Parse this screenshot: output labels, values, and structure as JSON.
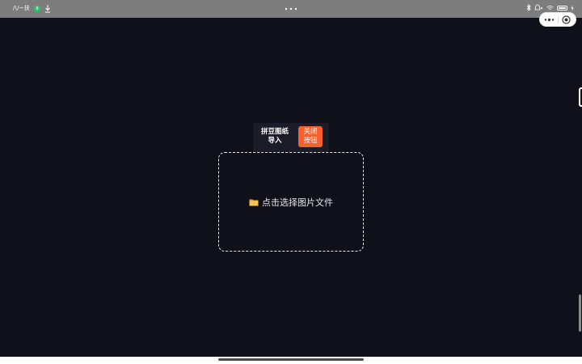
{
  "status_bar": {
    "time": "/\\/~扶",
    "badge": "9"
  },
  "capsule": {
    "more_icon": "more-dots-icon",
    "close_icon": "target-close-icon"
  },
  "toolbar": {
    "title_line1": "拼豆图纸",
    "title_line2": "导入",
    "close_line1": "关闭",
    "close_line2": "按钮"
  },
  "drop_zone": {
    "label": "点击选择图片文件",
    "icon": "folder-icon"
  },
  "colors": {
    "background": "#10101a",
    "toolbar_bg": "#1b1c29",
    "accent": "#f4612e",
    "status_bar": "#7d7d7d"
  }
}
